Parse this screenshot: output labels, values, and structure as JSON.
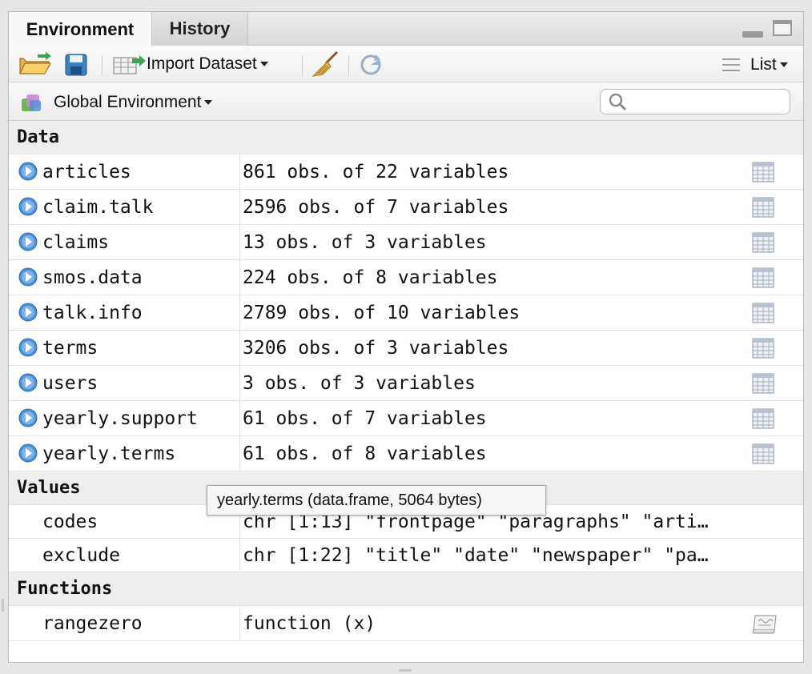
{
  "tabs": [
    {
      "label": "Environment",
      "active": true
    },
    {
      "label": "History",
      "active": false
    }
  ],
  "toolbar": {
    "import_label": "Import Dataset",
    "view_label": "List"
  },
  "environment_selector": {
    "label": "Global Environment"
  },
  "search": {
    "placeholder": ""
  },
  "sections": {
    "data": "Data",
    "values": "Values",
    "functions": "Functions"
  },
  "data_rows": [
    {
      "name": "articles",
      "value": "861 obs. of 22 variables"
    },
    {
      "name": "claim.talk",
      "value": "2596 obs. of 7 variables"
    },
    {
      "name": "claims",
      "value": "13 obs. of 3 variables"
    },
    {
      "name": "smos.data",
      "value": "224 obs. of 8 variables"
    },
    {
      "name": "talk.info",
      "value": "2789 obs. of 10 variables"
    },
    {
      "name": "terms",
      "value": "3206 obs. of 3 variables"
    },
    {
      "name": "users",
      "value": "3 obs. of 3 variables"
    },
    {
      "name": "yearly.support",
      "value": "61 obs. of 7 variables"
    },
    {
      "name": "yearly.terms",
      "value": "61 obs. of 8 variables"
    }
  ],
  "value_rows": [
    {
      "name": "codes",
      "value": "chr [1:13] \"frontpage\" \"paragraphs\" \"arti…"
    },
    {
      "name": "exclude",
      "value": "chr [1:22] \"title\" \"date\" \"newspaper\" \"pa…"
    }
  ],
  "function_rows": [
    {
      "name": "rangezero",
      "value": "function (x)"
    }
  ],
  "tooltip": {
    "text": "yearly.terms (data.frame, 5064 bytes)"
  },
  "colors": {
    "expand_icon": "#4a90d9",
    "accent_green": "#3aa655"
  }
}
